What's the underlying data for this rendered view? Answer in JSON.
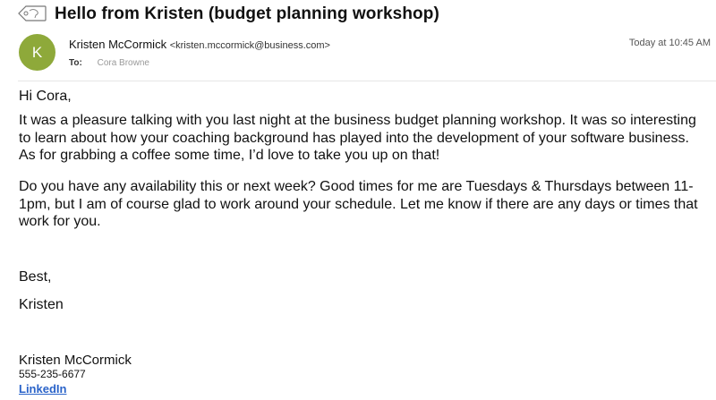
{
  "email": {
    "subject": "Hello from Kristen (budget planning workshop)",
    "avatar_initial": "K",
    "avatar_color": "#8ea93a",
    "sender_name": "Kristen McCormick",
    "sender_email": "<kristen.mccormick@business.com>",
    "timestamp": "Today at 10:45 AM",
    "to_label": "To:",
    "recipient": "Cora Browne",
    "body": {
      "greeting": "Hi Cora,",
      "paragraph1": "It was a pleasure talking with you last night at the business budget planning workshop. It was so interesting to learn about how your coaching background has played into the development of your software business. As for grabbing a coffee some time, I’d love to take you up on that!",
      "paragraph2": "Do you have any availability this or next week? Good times for me are Tuesdays & Thursdays between 11-1pm, but I am of course glad to work around your schedule. Let me know if there are any days or times that work for you.",
      "closing": "Best,",
      "signoff": "Kristen"
    },
    "signature": {
      "name": "Kristen McCormick",
      "phone": "555-235-6677",
      "link_label": "LinkedIn",
      "link_color": "#2a63c9"
    }
  },
  "icons": {
    "label_tag": "tag-icon"
  }
}
